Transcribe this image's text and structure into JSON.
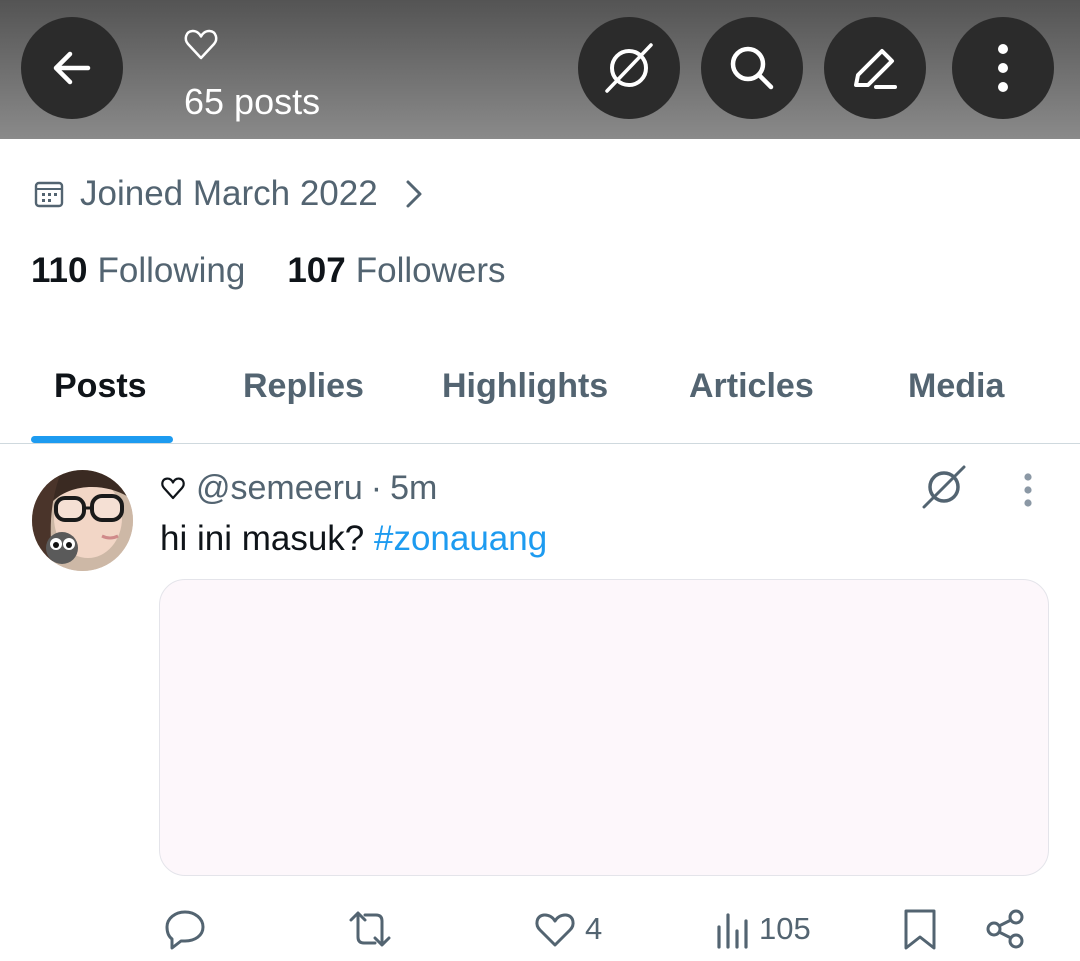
{
  "header": {
    "posts_count": "65 posts",
    "icons": {
      "back": "arrow-left-icon",
      "name": "heart-outline-icon",
      "no_ads": "circle-slash-icon",
      "search": "search-icon",
      "edit": "pencil-icon",
      "more": "more-vertical-icon"
    }
  },
  "profile": {
    "joined": "Joined March 2022",
    "following_count": "110",
    "following_label": "Following",
    "followers_count": "107",
    "followers_label": "Followers"
  },
  "tabs": [
    {
      "label": "Posts",
      "active": true
    },
    {
      "label": "Replies",
      "active": false
    },
    {
      "label": "Highlights",
      "active": false
    },
    {
      "label": "Articles",
      "active": false
    },
    {
      "label": "Media",
      "active": false
    }
  ],
  "post": {
    "handle": "@semeeru",
    "separator": "·",
    "time": "5m",
    "text": "hi ini masuk? ",
    "hashtag": "#zonauang",
    "actions": {
      "reply_count": "",
      "repost_count": "",
      "like_count": "4",
      "views_count": "105"
    }
  },
  "colors": {
    "accent": "#1d9bf0",
    "text_primary": "#0f1419",
    "text_secondary": "#536471",
    "header_button_bg": "#2b2b2b",
    "media_placeholder": "#fdf7fb"
  }
}
